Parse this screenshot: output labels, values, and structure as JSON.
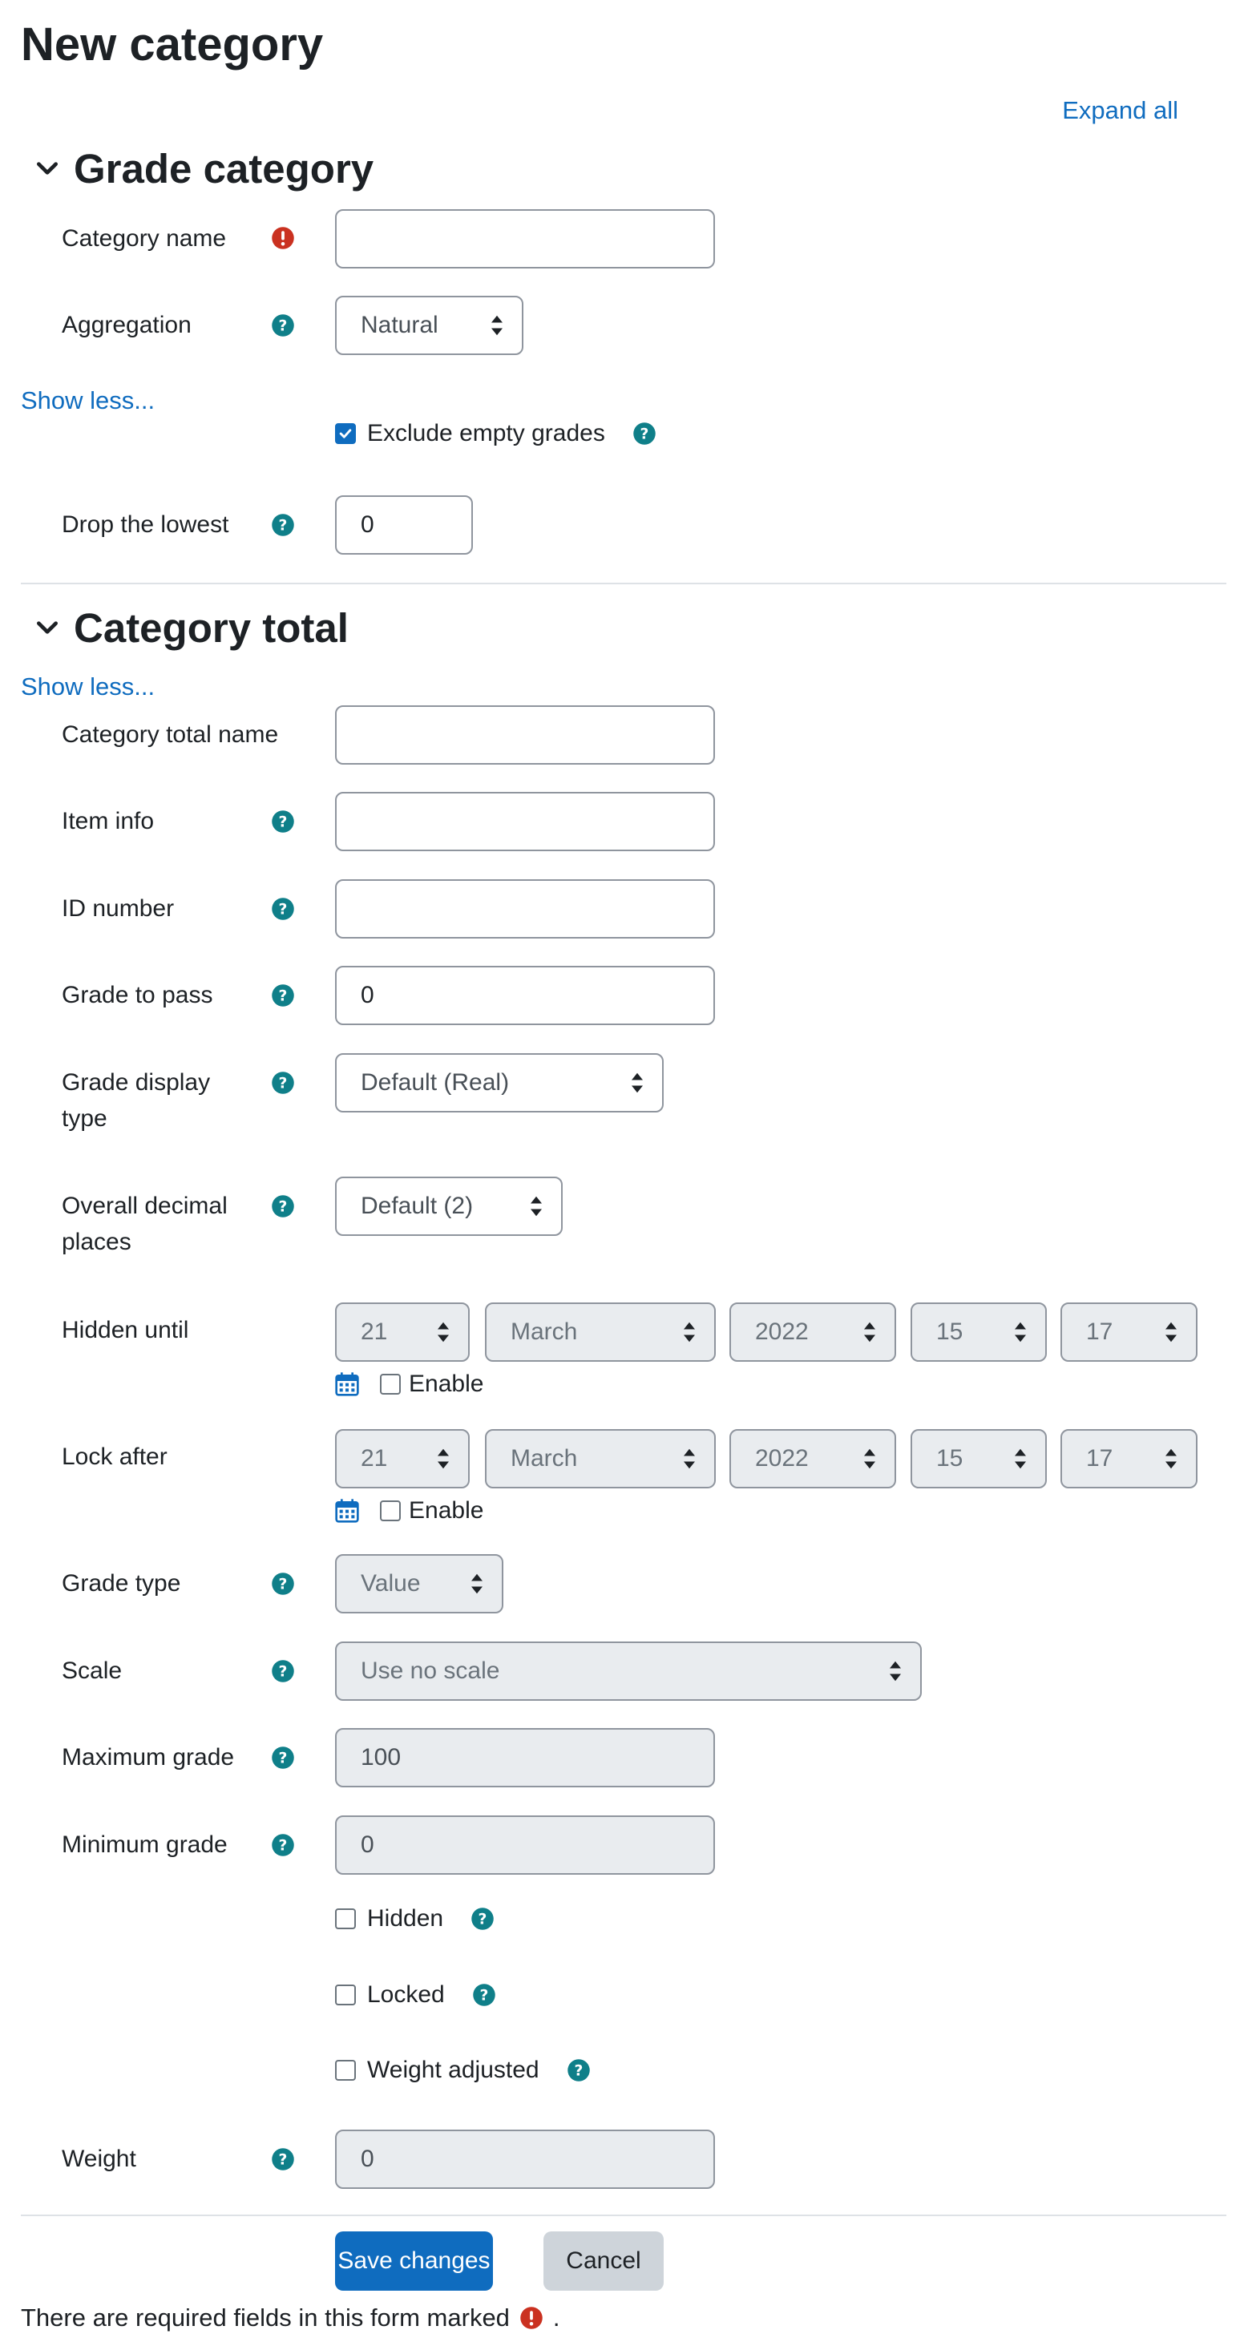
{
  "page": {
    "title": "New category",
    "expand_all": "Expand all"
  },
  "colors": {
    "link": "#0f6cbf",
    "help_icon": "#0f7f89",
    "required_icon": "#ca3120",
    "primary": "#0f6cbf",
    "secondary": "#ced4da"
  },
  "grade_category": {
    "heading": "Grade category",
    "category_name": {
      "label": "Category name",
      "value": "",
      "required_icon": "exclamation-circle-icon"
    },
    "aggregation": {
      "label": "Aggregation",
      "value": "Natural"
    },
    "show_less": "Show less...",
    "exclude_empty": {
      "label": "Exclude empty grades",
      "checked": true
    },
    "drop_lowest": {
      "label": "Drop the lowest",
      "value": "0"
    }
  },
  "category_total": {
    "heading": "Category total",
    "show_less": "Show less...",
    "total_name": {
      "label": "Category total name",
      "value": ""
    },
    "item_info": {
      "label": "Item info",
      "value": ""
    },
    "id_number": {
      "label": "ID number",
      "value": ""
    },
    "grade_to_pass": {
      "label": "Grade to pass",
      "value": "0"
    },
    "grade_display_type": {
      "label": "Grade display type",
      "value": "Default (Real)"
    },
    "decimal_places": {
      "label": "Overall decimal places",
      "value": "Default (2)"
    },
    "hidden_until": {
      "label": "Hidden until",
      "day": "21",
      "month": "March",
      "year": "2022",
      "hour": "15",
      "minute": "17",
      "enable": "Enable",
      "enabled": false
    },
    "lock_after": {
      "label": "Lock after",
      "day": "21",
      "month": "March",
      "year": "2022",
      "hour": "15",
      "minute": "17",
      "enable": "Enable",
      "enabled": false
    },
    "grade_type": {
      "label": "Grade type",
      "value": "Value"
    },
    "scale": {
      "label": "Scale",
      "value": "Use no scale"
    },
    "max_grade": {
      "label": "Maximum grade",
      "value": "100"
    },
    "min_grade": {
      "label": "Minimum grade",
      "value": "0"
    },
    "hidden": {
      "label": "Hidden",
      "checked": false
    },
    "locked": {
      "label": "Locked",
      "checked": false
    },
    "weight_adjusted": {
      "label": "Weight adjusted",
      "checked": false
    },
    "weight": {
      "label": "Weight",
      "value": "0"
    }
  },
  "buttons": {
    "save": "Save changes",
    "cancel": "Cancel"
  },
  "footer": {
    "required_note": "There are required fields in this form marked",
    "period": "."
  }
}
